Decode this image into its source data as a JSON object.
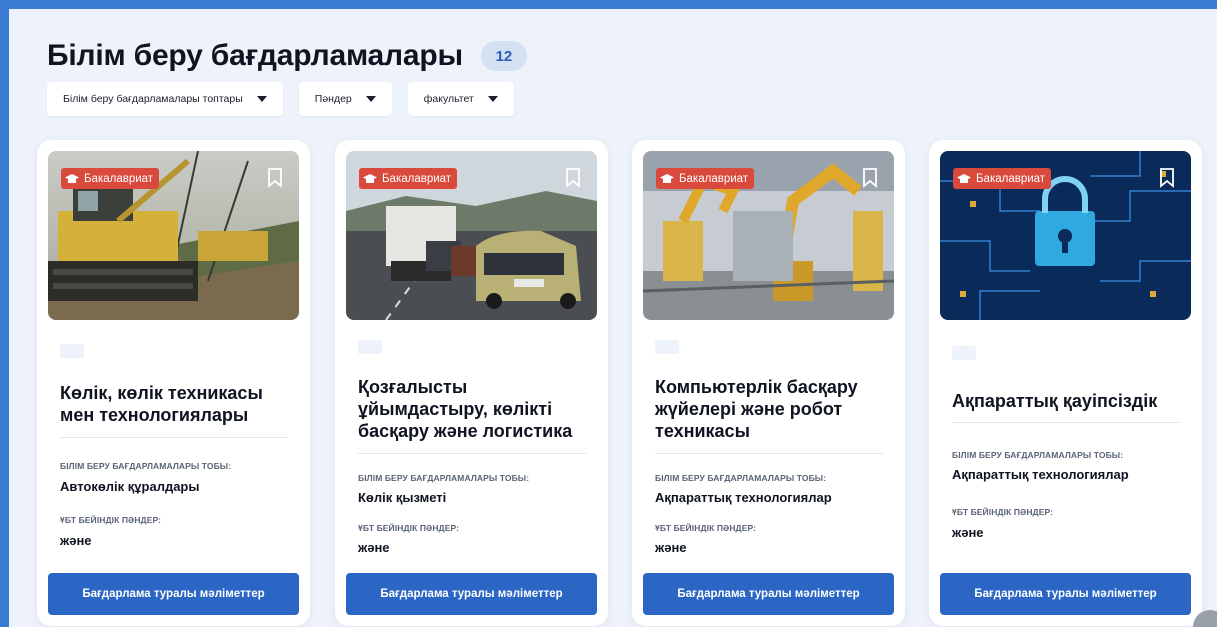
{
  "page": {
    "title": "Білім беру бағдарламалары",
    "count": "12"
  },
  "filters": [
    {
      "label": "Білім беру бағдарламалары топтары"
    },
    {
      "label": "Пәндер"
    },
    {
      "label": "факультет"
    }
  ],
  "cards": [
    {
      "badge": "Бакалавриат",
      "title": "Көлік, көлік техникасы мен технологиялары",
      "group_label": "БІЛІМ БЕРУ БАҒДАРЛАМАЛАРЫ ТОБЫ:",
      "group_value": "Автокөлік құралдары",
      "subjects_label": "ҰБТ БЕЙІНДІК ПӘНДЕР:",
      "subjects_value": "және",
      "button": "Бағдарлама туралы мәліметтер",
      "image": "construction-pipeline-machinery"
    },
    {
      "badge": "Бакалавриат",
      "title": "Қозғалысты ұйымдастыру, көлікті басқару және логистика",
      "group_label": "БІЛІМ БЕРУ БАҒДАРЛАМАЛАРЫ ТОБЫ:",
      "group_value": "Көлік қызметі",
      "subjects_label": "ҰБТ БЕЙІНДІК ПӘНДЕР:",
      "subjects_value": "және",
      "button": "Бағдарлама туралы мәліметтер",
      "image": "highway-traffic-cars"
    },
    {
      "badge": "Бакалавриат",
      "title": "Компьютерлік басқару жүйелері және робот техникасы",
      "group_label": "БІЛІМ БЕРУ БАҒДАРЛАМАЛАРЫ ТОБЫ:",
      "group_value": "Ақпараттық технологиялар",
      "subjects_label": "ҰБТ БЕЙІНДІК ПӘНДЕР:",
      "subjects_value": "және",
      "button": "Бағдарлама туралы мәліметтер",
      "image": "industrial-robot-arms"
    },
    {
      "badge": "Бакалавриат",
      "title": "Ақпараттық қауіпсіздік",
      "group_label": "БІЛІМ БЕРУ БАҒДАРЛАМАЛАРЫ ТОБЫ:",
      "group_value": "Ақпараттық технологиялар",
      "subjects_label": "ҰБТ БЕЙІНДІК ПӘНДЕР:",
      "subjects_value": "және",
      "button": "Бағдарлама туралы мәліметтер",
      "image": "circuit-board-padlock"
    }
  ],
  "colors": {
    "accent": "#2b66c4",
    "badge": "#d94a3d",
    "frame": "#3a7bd5",
    "background": "#eef2fa"
  }
}
